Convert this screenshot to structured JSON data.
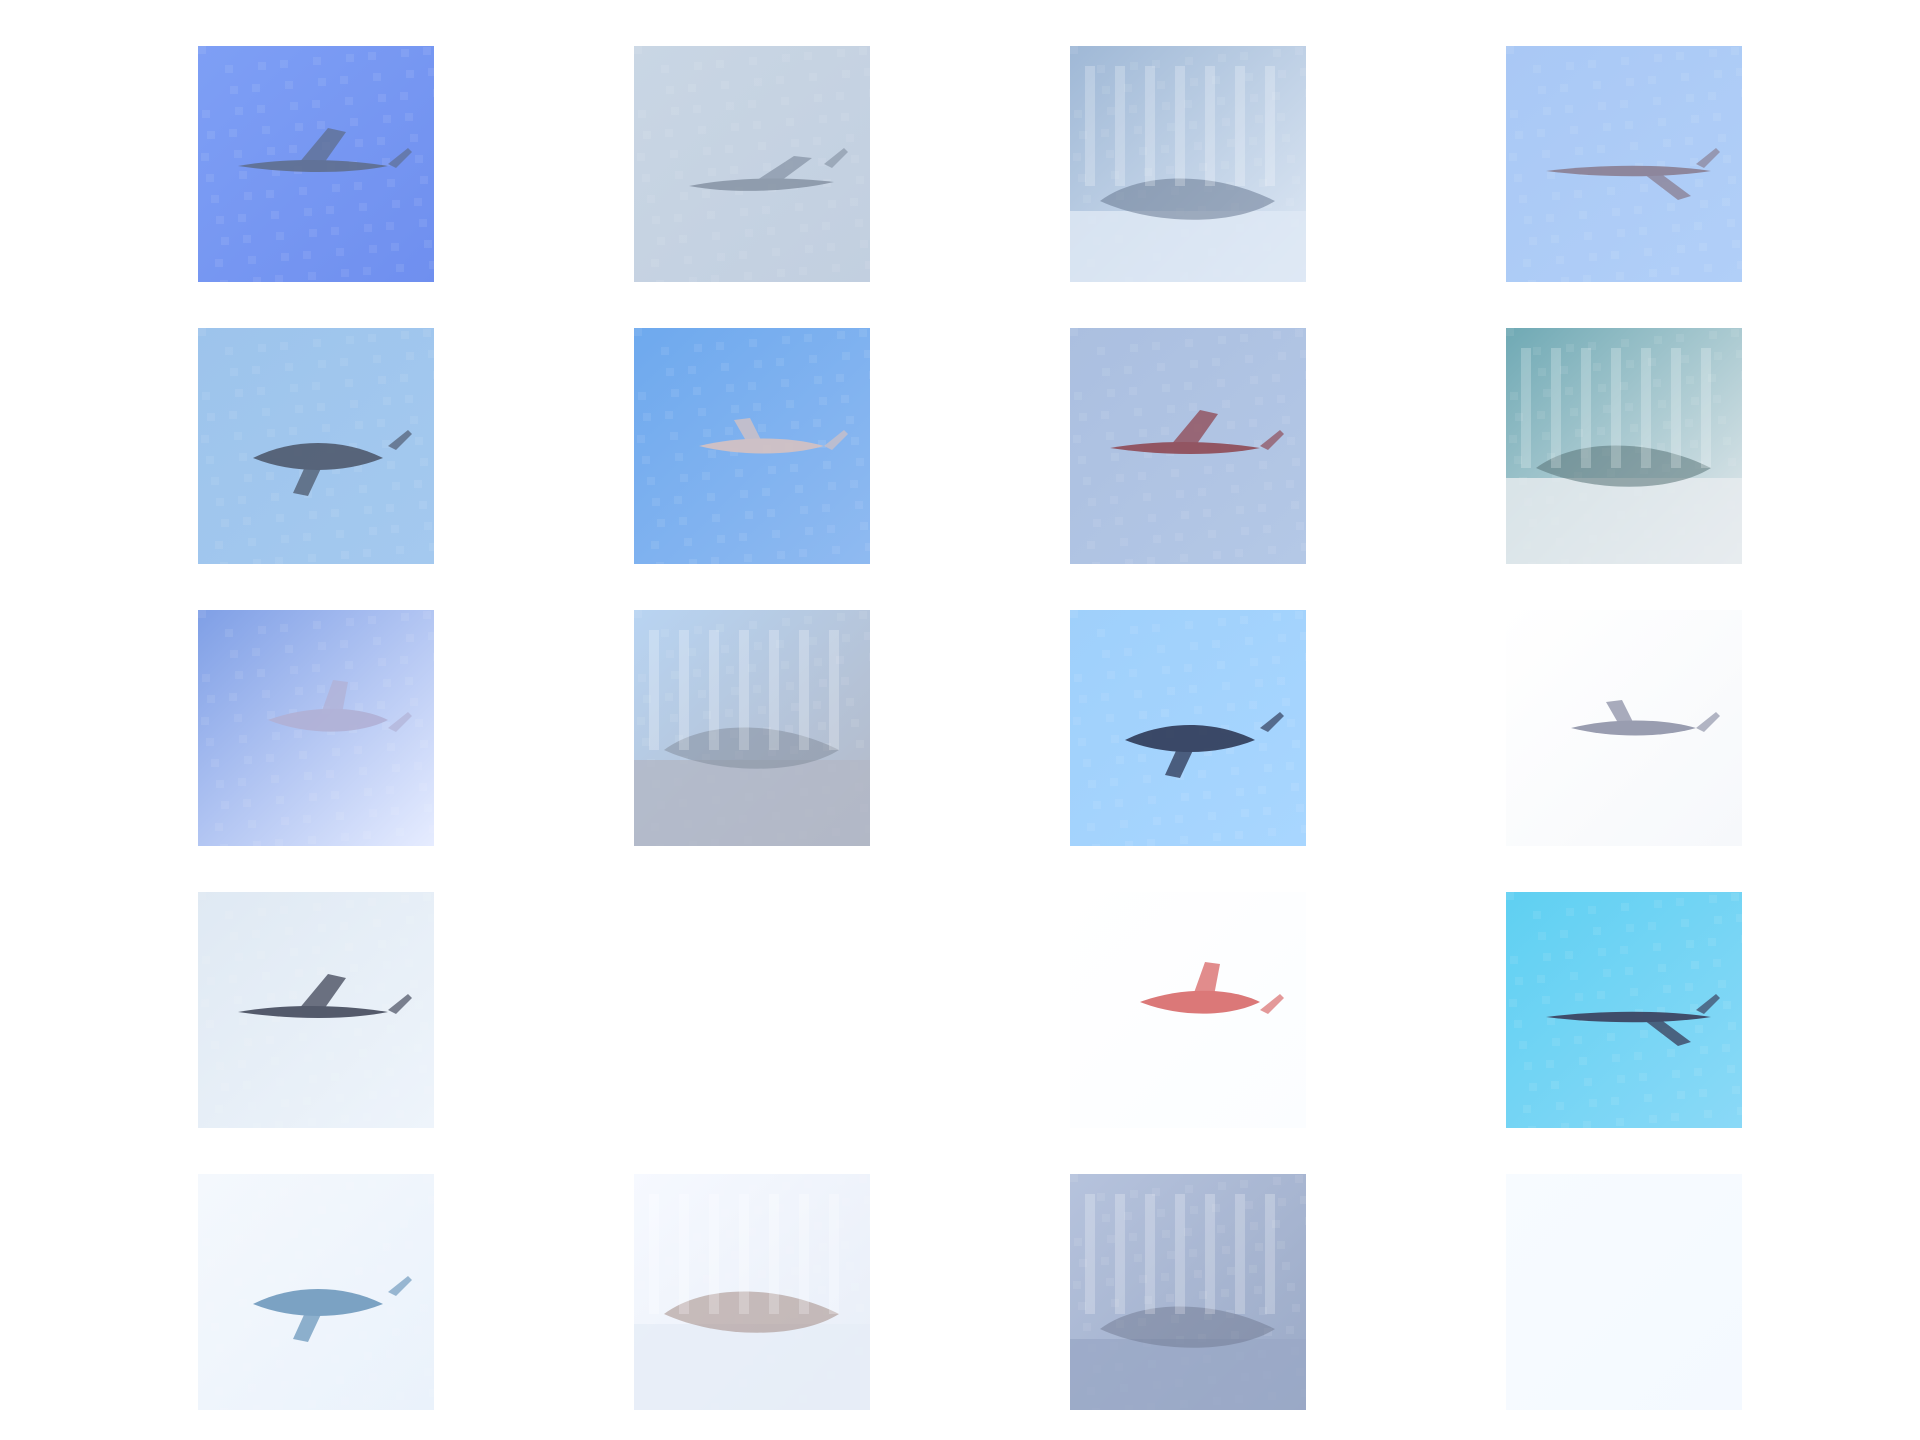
{
  "grid": {
    "rows": 5,
    "cols": 4,
    "tiles": [
      {
        "id": "tile-r1c1",
        "subject": "aircraft-silhouette",
        "bg": "#7e9ff5",
        "bg2": "#6f8fef",
        "fg": "#5f6f8f"
      },
      {
        "id": "tile-r1c2",
        "subject": "aircraft-silhouette",
        "bg": "#c9d6e4",
        "bg2": "#c2cfe0",
        "fg": "#8a97a8"
      },
      {
        "id": "tile-r1c3",
        "subject": "scene-vehicle",
        "bg": "#9fb8d6",
        "bg2": "#dfe9f5",
        "fg": "#5f7088"
      },
      {
        "id": "tile-r1c4",
        "subject": "aircraft-silhouette",
        "bg": "#a9c8f5",
        "bg2": "#b1cff8",
        "fg": "#8a7f93"
      },
      {
        "id": "tile-r2c1",
        "subject": "aircraft-silhouette",
        "bg": "#9dc4ec",
        "bg2": "#a4c9ef",
        "fg": "#4f5a6e"
      },
      {
        "id": "tile-r2c2",
        "subject": "aircraft-silhouette",
        "bg": "#6ea9ee",
        "bg2": "#8fbaf1",
        "fg": "#d6c2c2"
      },
      {
        "id": "tile-r2c3",
        "subject": "aircraft-silhouette",
        "bg": "#abbfe0",
        "bg2": "#b4c8e6",
        "fg": "#8f4a55"
      },
      {
        "id": "tile-r2c4",
        "subject": "scene-vehicle",
        "bg": "#6fa9b4",
        "bg2": "#e8ecef",
        "fg": "#4f6a6e"
      },
      {
        "id": "tile-r3c1",
        "subject": "aircraft-silhouette",
        "bg": "#7f9fe6",
        "bg2": "#e6ecff",
        "fg": "#b1b1d6"
      },
      {
        "id": "tile-r3c2",
        "subject": "scene-vehicle",
        "bg": "#b8d4f2",
        "bg2": "#b3b8c6",
        "fg": "#7f8898"
      },
      {
        "id": "tile-r3c3",
        "subject": "aircraft-silhouette",
        "bg": "#9fd0fb",
        "bg2": "#a8d6ff",
        "fg": "#2f3a57"
      },
      {
        "id": "tile-r3c4",
        "subject": "aircraft-silhouette",
        "bg": "#ffffff",
        "bg2": "#f6f8fb",
        "fg": "#8f93a8"
      },
      {
        "id": "tile-r4c1",
        "subject": "aircraft-silhouette",
        "bg": "#dfe9f3",
        "bg2": "#eef4fb",
        "fg": "#444a5c"
      },
      {
        "id": "tile-r4c2",
        "subject": "blank",
        "bg": "#ffffff",
        "bg2": "#ffffff",
        "fg": "#ffffff"
      },
      {
        "id": "tile-r4c3",
        "subject": "aircraft-silhouette",
        "bg": "#ffffff",
        "bg2": "#fbfdff",
        "fg": "#d86a6a"
      },
      {
        "id": "tile-r4c4",
        "subject": "aircraft-silhouette",
        "bg": "#5fd0f2",
        "bg2": "#8ad9f7",
        "fg": "#3a3f5c"
      },
      {
        "id": "tile-r5c1",
        "subject": "aircraft-silhouette",
        "bg": "#f4f8fd",
        "bg2": "#eaf2fb",
        "fg": "#6f9abd"
      },
      {
        "id": "tile-r5c2",
        "subject": "scene-vehicle",
        "bg": "#f6f9ff",
        "bg2": "#e7edf7",
        "fg": "#9a7f77"
      },
      {
        "id": "tile-r5c3",
        "subject": "scene-vehicle",
        "bg": "#b6c3dd",
        "bg2": "#9aa9c6",
        "fg": "#6f7890"
      },
      {
        "id": "tile-r5c4",
        "subject": "blank",
        "bg": "#f7fbff",
        "bg2": "#f4f9ff",
        "fg": "#3b4b6a"
      }
    ]
  }
}
